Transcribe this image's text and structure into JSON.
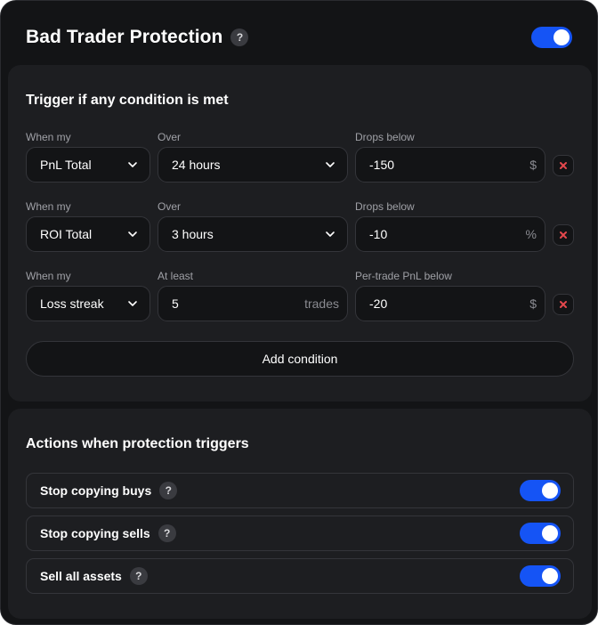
{
  "header": {
    "title": "Bad Trader Protection",
    "help": "?",
    "enabled": true
  },
  "triggers": {
    "title": "Trigger if any condition is met",
    "conditions": [
      {
        "label1": "When my",
        "metric": "PnL Total",
        "label2": "Over",
        "param": "24 hours",
        "param_type": "select",
        "label3": "Drops below",
        "threshold": "-150",
        "unit": "$"
      },
      {
        "label1": "When my",
        "metric": "ROI Total",
        "label2": "Over",
        "param": "3 hours",
        "param_type": "select",
        "label3": "Drops below",
        "threshold": "-10",
        "unit": "%"
      },
      {
        "label1": "When my",
        "metric": "Loss streak",
        "label2": "At least",
        "param": "5",
        "param_unit": "trades",
        "param_type": "input",
        "label3": "Per-trade PnL below",
        "threshold": "-20",
        "unit": "$"
      }
    ],
    "add_label": "Add condition"
  },
  "actions": {
    "title": "Actions when protection triggers",
    "items": [
      {
        "label": "Stop copying buys",
        "help": "?",
        "enabled": true
      },
      {
        "label": "Stop copying sells",
        "help": "?",
        "enabled": true
      },
      {
        "label": "Sell all assets",
        "help": "?",
        "enabled": true
      }
    ]
  },
  "colors": {
    "accent": "#1554f5",
    "delete": "#e5484d",
    "background": "#131416",
    "card": "#1d1e21"
  }
}
